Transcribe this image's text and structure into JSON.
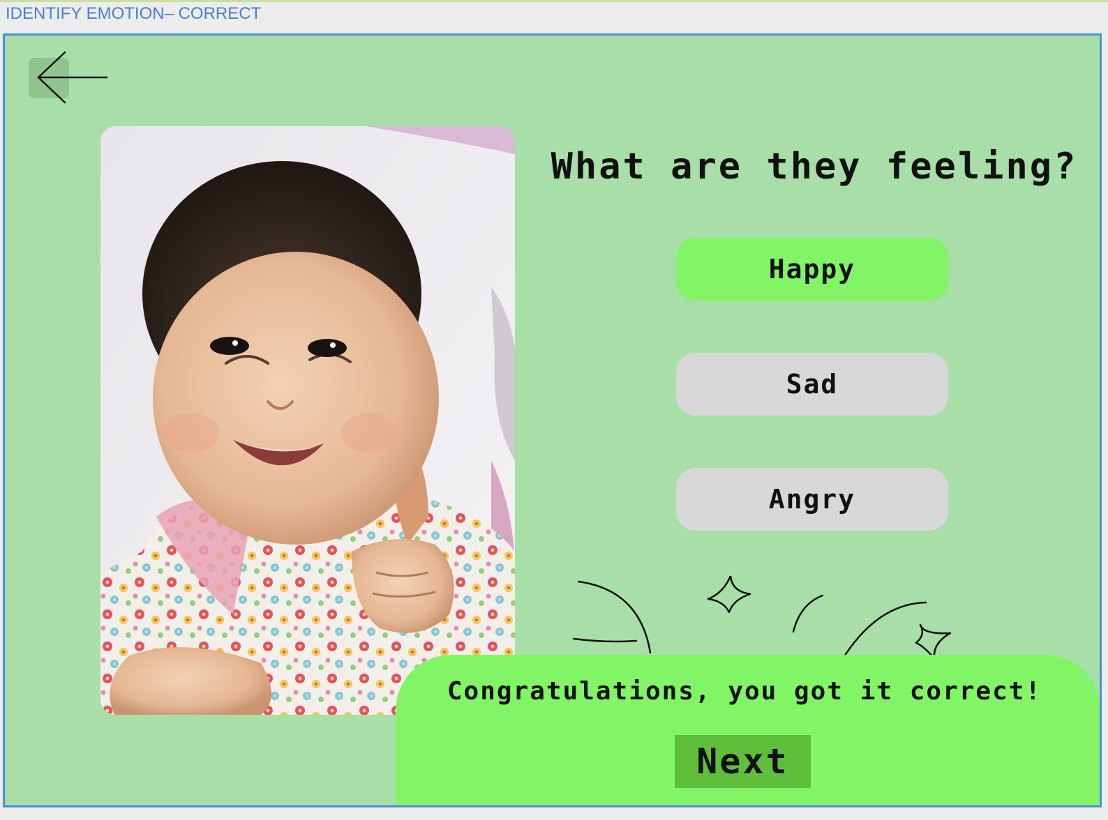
{
  "window": {
    "title": "IDENTIFY EMOTION– CORRECT"
  },
  "nav": {
    "back_icon": "arrow-left-icon"
  },
  "photo": {
    "subject": "smiling-baby-photo"
  },
  "quiz": {
    "question": "What are they feeling?",
    "options": [
      {
        "label": "Happy",
        "state": "correct"
      },
      {
        "label": "Sad",
        "state": "neutral"
      },
      {
        "label": "Angry",
        "state": "neutral"
      }
    ]
  },
  "result": {
    "message": "Congratulations, you got it correct!",
    "next_label": "Next"
  },
  "colors": {
    "background": "#a8dea8",
    "correct": "#82f566",
    "neutral": "#d8d8d8",
    "next_button": "#5fbf3c",
    "frame_border": "#4a8fdc",
    "title_text": "#4a7fd0"
  }
}
